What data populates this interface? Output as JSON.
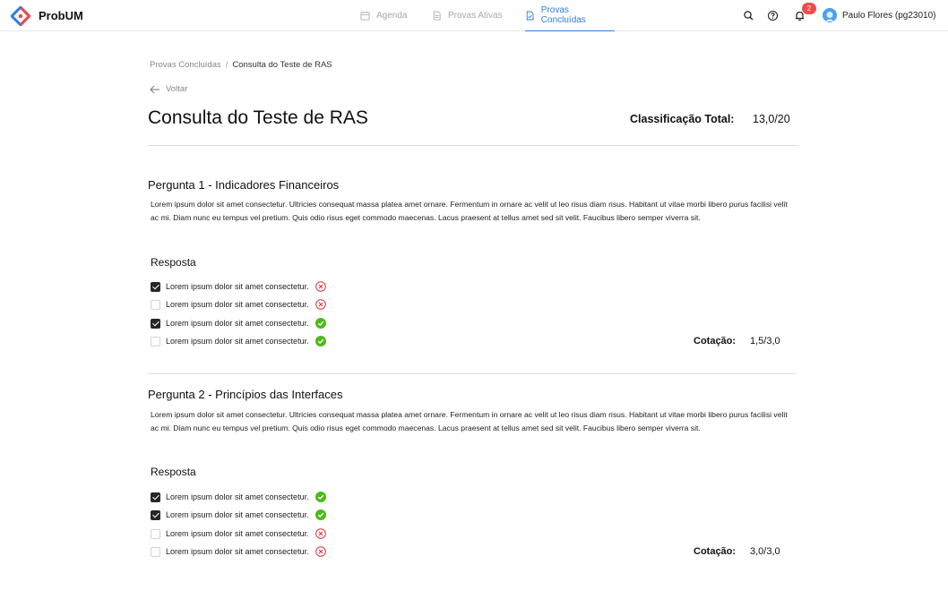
{
  "app": {
    "name": "ProbUM"
  },
  "nav": [
    {
      "label": "Agenda",
      "icon": "calendar-icon",
      "active": false
    },
    {
      "label": "Provas Ativas",
      "icon": "document-icon",
      "active": false
    },
    {
      "label": "Provas Concluídas",
      "icon": "document-check-icon",
      "active": true
    }
  ],
  "header": {
    "notifications_count": "2",
    "user_name": "Paulo Flores (pg23010)",
    "icons": [
      "search-icon",
      "help-icon",
      "bell-icon",
      "avatar"
    ]
  },
  "breadcrumb": {
    "parent": "Provas Concluídas",
    "separator": "/",
    "current": "Consulta do Teste de RAS"
  },
  "back_label": "Voltar",
  "page": {
    "title": "Consulta do Teste de RAS",
    "total_label": "Classificação Total:",
    "total_value": "13,0/20"
  },
  "questions": [
    {
      "title": "Pergunta 1 - Indicadores Financeiros",
      "text": "Lorem ipsum dolor sit amet consectetur. Ultricies consequat massa platea amet ornare. Fermentum in ornare ac velit ut leo risus diam risus. Habitant ut vitae morbi libero purus facilisi velit ac mi. Diam nunc eu tempus vel pretium. Quis odio risus eget commodo maecenas. Lacus praesent at tellus amet sed sit velit. Faucibus libero semper viverra sit.",
      "answer_label": "Resposta",
      "options": [
        {
          "label": "Lorem ipsum dolor sit amet consectetur.",
          "checked": true,
          "result": "wrong"
        },
        {
          "label": "Lorem ipsum dolor sit amet consectetur.",
          "checked": false,
          "result": "wrong"
        },
        {
          "label": "Lorem ipsum dolor sit amet consectetur.",
          "checked": true,
          "result": "correct"
        },
        {
          "label": "Lorem ipsum dolor sit amet consectetur.",
          "checked": false,
          "result": "correct"
        }
      ],
      "score_label": "Cotação:",
      "score_value": "1,5/3,0"
    },
    {
      "title": "Pergunta 2 - Princípios das Interfaces",
      "text": "Lorem ipsum dolor sit amet consectetur. Ultricies consequat massa platea amet ornare. Fermentum in ornare ac velit ut leo risus diam risus. Habitant ut vitae morbi libero purus facilisi velit ac mi. Diam nunc eu tempus vel pretium. Quis odio risus eget commodo maecenas. Lacus praesent at tellus amet sed sit velit. Faucibus libero semper viverra sit.",
      "answer_label": "Resposta",
      "options": [
        {
          "label": "Lorem ipsum dolor sit amet consectetur.",
          "checked": true,
          "result": "correct"
        },
        {
          "label": "Lorem ipsum dolor sit amet consectetur.",
          "checked": true,
          "result": "correct"
        },
        {
          "label": "Lorem ipsum dolor sit amet consectetur.",
          "checked": false,
          "result": "wrong"
        },
        {
          "label": "Lorem ipsum dolor sit amet consectetur.",
          "checked": false,
          "result": "wrong"
        }
      ],
      "score_label": "Cotação:",
      "score_value": "3,0/3,0"
    }
  ],
  "colors": {
    "accent": "#2f7de1",
    "badge": "#ef4b4b",
    "correct": "#4cbb17",
    "wrong": "#e0333a",
    "checkbox_checked": "#262626"
  }
}
